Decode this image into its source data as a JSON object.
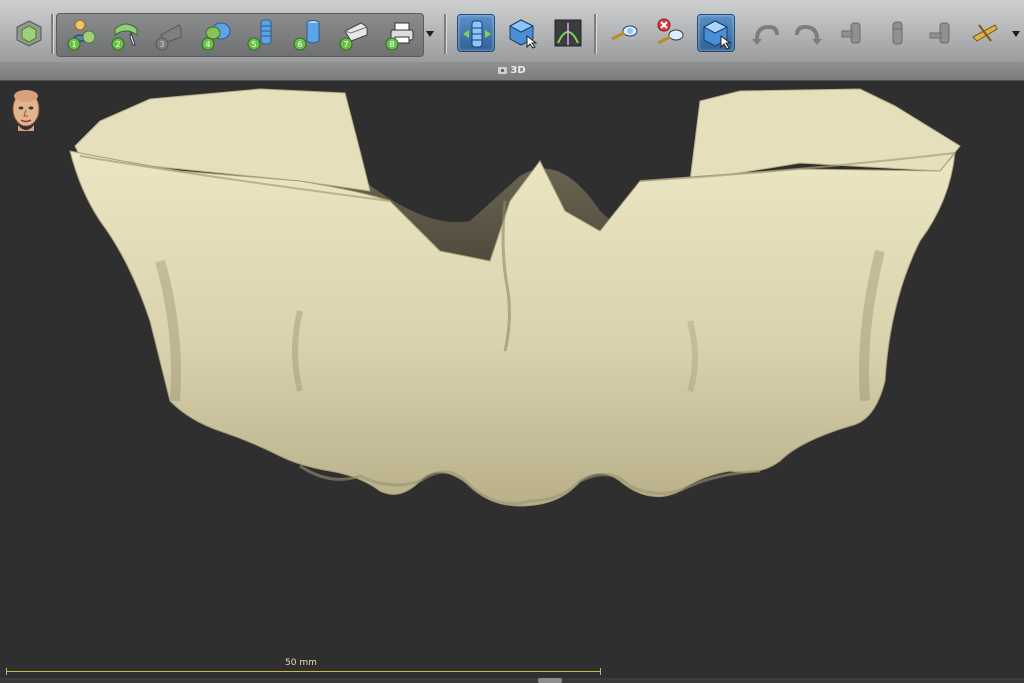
{
  "toolbar": {
    "workflow_steps": [
      {
        "number": "1",
        "icon": "patient-data-icon",
        "enabled": true
      },
      {
        "number": "2",
        "icon": "panoramic-curve-icon",
        "enabled": true
      },
      {
        "number": "3",
        "icon": "nerve-canal-icon",
        "enabled": false
      },
      {
        "number": "4",
        "icon": "crown-placement-icon",
        "enabled": true
      },
      {
        "number": "5",
        "icon": "implant-planning-icon",
        "enabled": true
      },
      {
        "number": "6",
        "icon": "abutment-icon",
        "enabled": true
      },
      {
        "number": "7",
        "icon": "guide-design-icon",
        "enabled": true
      },
      {
        "number": "8",
        "icon": "print-order-icon",
        "enabled": true
      }
    ],
    "tools": [
      {
        "icon": "implant-view-icon",
        "active": true
      },
      {
        "icon": "cube-select-icon",
        "active": false
      },
      {
        "icon": "reslice-view-icon",
        "active": false
      },
      {
        "icon": "measure-distance-icon",
        "active": false
      },
      {
        "icon": "delete-measurement-icon",
        "active": false
      },
      {
        "icon": "select-object-icon",
        "active": true
      },
      {
        "icon": "undo-icon",
        "active": false
      },
      {
        "icon": "redo-icon",
        "active": false
      },
      {
        "icon": "implant-gray-1-icon",
        "active": false
      },
      {
        "icon": "implant-gray-2-icon",
        "active": false
      },
      {
        "icon": "implant-gray-3-icon",
        "active": false
      },
      {
        "icon": "implant-gray-4-icon",
        "active": false
      },
      {
        "icon": "cut-tool-icon",
        "active": false
      }
    ]
  },
  "viewport": {
    "title": "3D",
    "model_color": "#d8d1ab",
    "background_color": "#2f2f30"
  },
  "scale": {
    "label": "50 mm"
  },
  "colors": {
    "active_button": "#3f74ad",
    "scale_bar": "#c6b94a"
  }
}
